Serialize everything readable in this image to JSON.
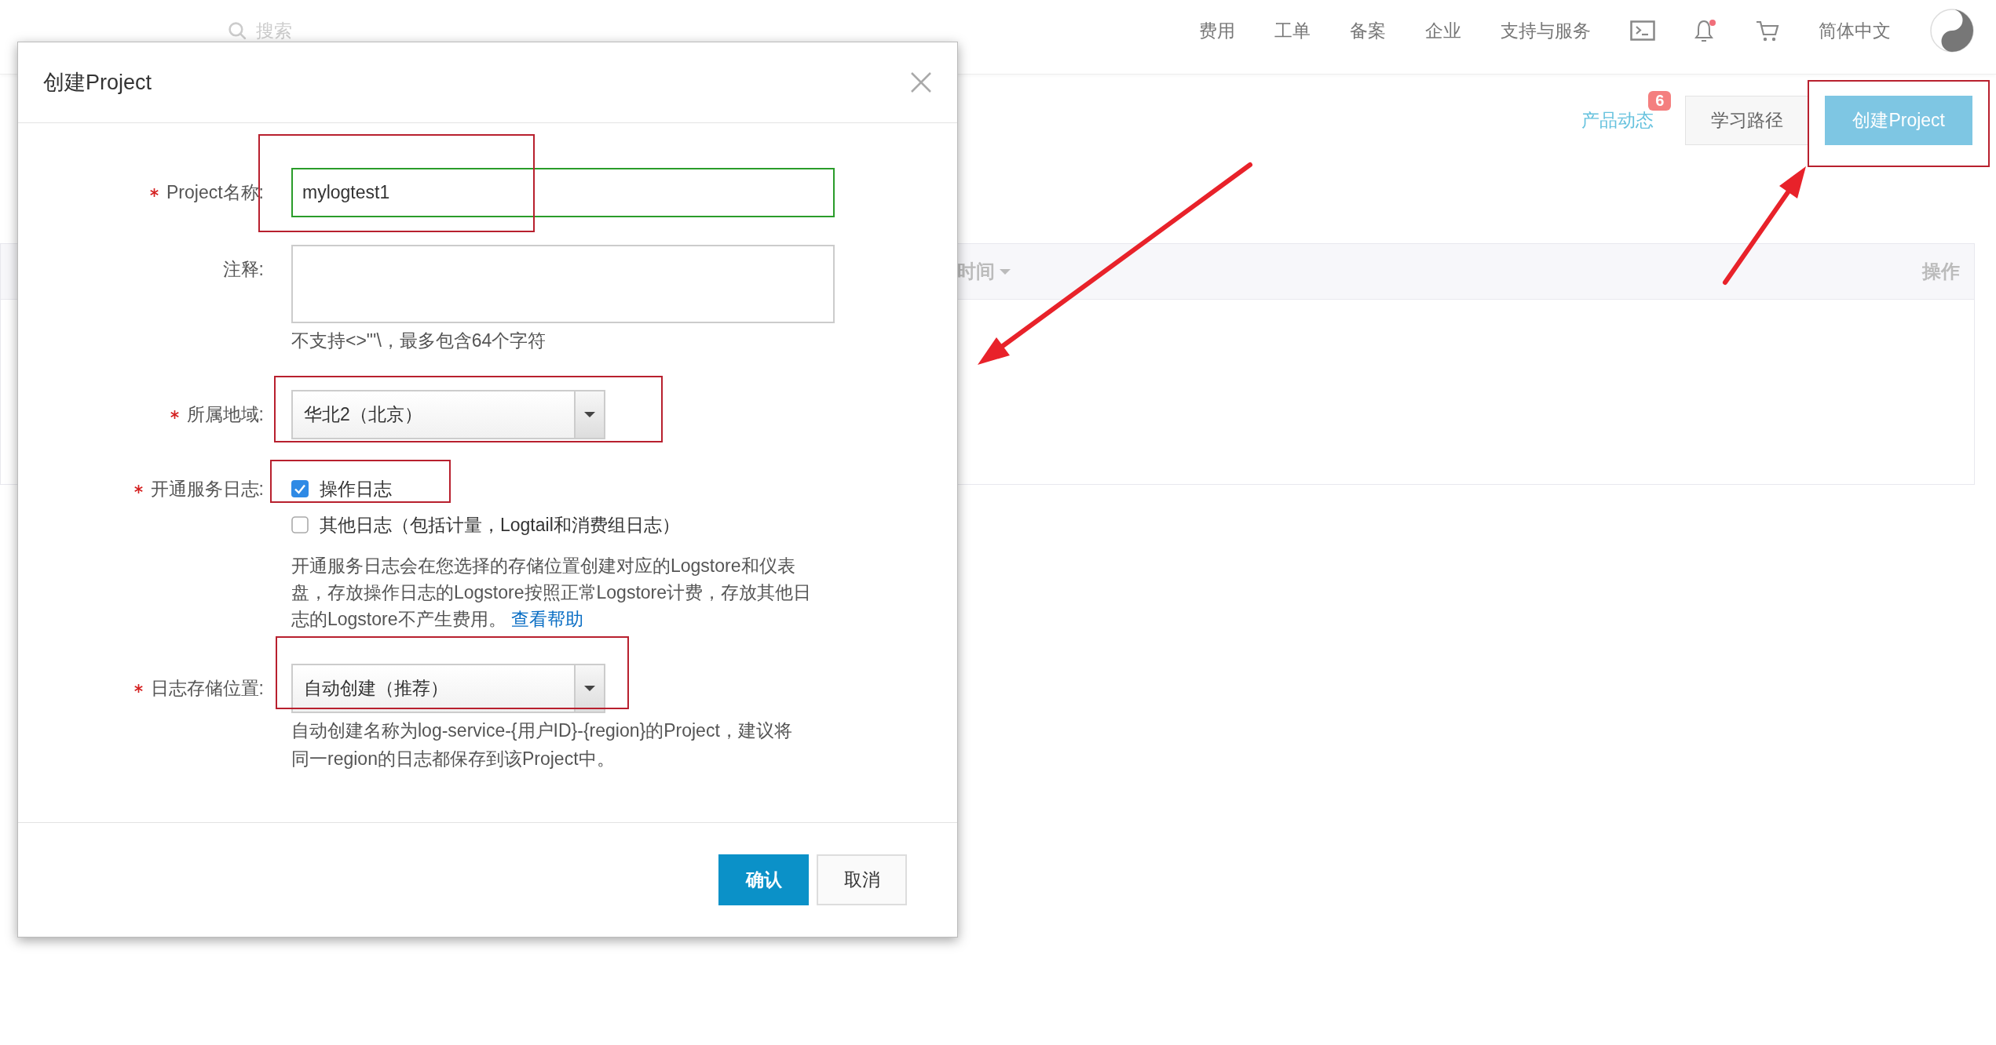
{
  "top_nav": {
    "search": {
      "placeholder": "搜索"
    },
    "items": [
      "费用",
      "工单",
      "备案",
      "企业",
      "支持与服务"
    ],
    "notifications_unread": true,
    "language": "简体中文"
  },
  "toolbar": {
    "news": {
      "label": "产品动态",
      "badge": "6"
    },
    "buttons": [
      {
        "label": "学习路径",
        "kind": "default"
      },
      {
        "label": "创建Project",
        "kind": "primary"
      }
    ]
  },
  "table": {
    "columns": [
      {
        "label": "时间",
        "sortable": true
      },
      {
        "label": "操作",
        "sortable": false
      }
    ]
  },
  "dialog": {
    "title": "创建Project",
    "fields": [
      {
        "kind": "text",
        "label": "Project名称:",
        "required": true,
        "value": "mylogtest1",
        "valid": true
      },
      {
        "kind": "textarea",
        "label": "注释:",
        "required": false,
        "hint": "不支持<>\"'\\，最多包含64个字符"
      },
      {
        "kind": "select",
        "label": "所属地域:",
        "required": true,
        "value": "华北2（北京）"
      },
      {
        "kind": "checkboxes",
        "label": "开通服务日志:",
        "required": true,
        "options": [
          {
            "label": "操作日志",
            "checked": true
          },
          {
            "label": "其他日志（包括计量，Logtail和消费组日志）",
            "checked": false
          }
        ],
        "description": "开通服务日志会在您选择的存储位置创建对应的Logstore和仪表盘，存放操作日志的Logstore按照正常Logstore计费，存放其他日志的Logstore不产生费用。",
        "link": "查看帮助"
      },
      {
        "kind": "select",
        "label": "日志存储位置:",
        "required": true,
        "value": "自动创建（推荐）",
        "hint": "自动创建名称为log-service-{用户ID}-{region}的Project，建议将同一region的日志都保存到该Project中。"
      }
    ],
    "buttons": [
      {
        "label": "确认",
        "kind": "primary"
      },
      {
        "label": "取消",
        "kind": "default"
      }
    ]
  }
}
